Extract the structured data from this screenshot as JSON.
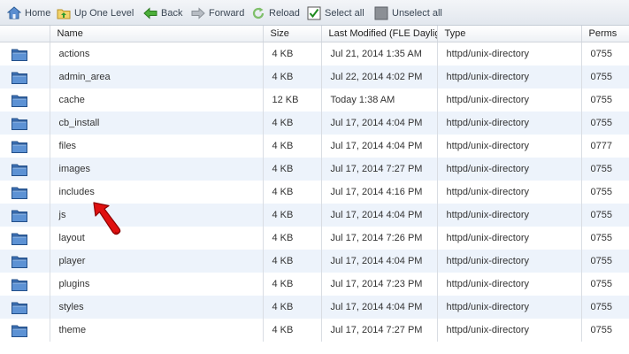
{
  "toolbar": {
    "home": "Home",
    "up": "Up One Level",
    "back": "Back",
    "forward": "Forward",
    "reload": "Reload",
    "select_all": "Select all",
    "unselect_all": "Unselect all"
  },
  "columns": {
    "name": "Name",
    "size": "Size",
    "modified": "Last Modified (FLE Daylig",
    "type": "Type",
    "perms": "Perms"
  },
  "rows": [
    {
      "name": "actions",
      "size": "4 KB",
      "modified": "Jul 21, 2014 1:35 AM",
      "type": "httpd/unix-directory",
      "perms": "0755"
    },
    {
      "name": "admin_area",
      "size": "4 KB",
      "modified": "Jul 22, 2014 4:02 PM",
      "type": "httpd/unix-directory",
      "perms": "0755"
    },
    {
      "name": "cache",
      "size": "12 KB",
      "modified": "Today 1:38 AM",
      "type": "httpd/unix-directory",
      "perms": "0755"
    },
    {
      "name": "cb_install",
      "size": "4 KB",
      "modified": "Jul 17, 2014 4:04 PM",
      "type": "httpd/unix-directory",
      "perms": "0755"
    },
    {
      "name": "files",
      "size": "4 KB",
      "modified": "Jul 17, 2014 4:04 PM",
      "type": "httpd/unix-directory",
      "perms": "0777"
    },
    {
      "name": "images",
      "size": "4 KB",
      "modified": "Jul 17, 2014 7:27 PM",
      "type": "httpd/unix-directory",
      "perms": "0755"
    },
    {
      "name": "includes",
      "size": "4 KB",
      "modified": "Jul 17, 2014 4:16 PM",
      "type": "httpd/unix-directory",
      "perms": "0755"
    },
    {
      "name": "js",
      "size": "4 KB",
      "modified": "Jul 17, 2014 4:04 PM",
      "type": "httpd/unix-directory",
      "perms": "0755"
    },
    {
      "name": "layout",
      "size": "4 KB",
      "modified": "Jul 17, 2014 7:26 PM",
      "type": "httpd/unix-directory",
      "perms": "0755"
    },
    {
      "name": "player",
      "size": "4 KB",
      "modified": "Jul 17, 2014 4:04 PM",
      "type": "httpd/unix-directory",
      "perms": "0755"
    },
    {
      "name": "plugins",
      "size": "4 KB",
      "modified": "Jul 17, 2014 7:23 PM",
      "type": "httpd/unix-directory",
      "perms": "0755"
    },
    {
      "name": "styles",
      "size": "4 KB",
      "modified": "Jul 17, 2014 4:04 PM",
      "type": "httpd/unix-directory",
      "perms": "0755"
    },
    {
      "name": "theme",
      "size": "4 KB",
      "modified": "Jul 17, 2014 7:27 PM",
      "type": "httpd/unix-directory",
      "perms": "0755"
    }
  ],
  "icons": {
    "row": "folder-icon",
    "annotation": "red-arrow-icon"
  },
  "colors": {
    "row_alt": "#edf3fb",
    "folder": "#4a7fc1",
    "arrow": "#e01010"
  }
}
